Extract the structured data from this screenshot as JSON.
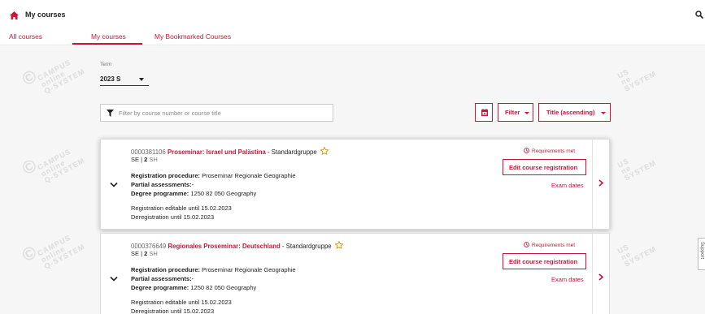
{
  "header": {
    "title": "My courses",
    "tabs": [
      {
        "label": "All courses"
      },
      {
        "label": "My courses"
      },
      {
        "label": "My Bookmarked Courses"
      }
    ]
  },
  "watermark": {
    "line1": "CAMPUS",
    "line2": "online",
    "line3": "Q-SYSTEM",
    "partial1": "US",
    "partial2": "ne",
    "partial3": "SYSTEM"
  },
  "term": {
    "label": "Term",
    "value": "2023 S"
  },
  "filter": {
    "placeholder": "Filter by course number or course title"
  },
  "toolbar": {
    "filter_label": "Filter",
    "sort_label": "Title (ascending)"
  },
  "colors": {
    "accent": "#c5183b"
  },
  "courses": [
    {
      "number": "0000381106",
      "title": "Proseminar: Israel und Palästina",
      "group": "- Standardgruppe",
      "type": "SE",
      "sh": "2",
      "sh_unit": "SH",
      "registration_procedure_label": "Registration procedure:",
      "registration_procedure": "Proseminar Regionale Geographie",
      "partial_assessments_label": "Partial assessments:",
      "partial_assessments": "-",
      "degree_programme_label": "Degree programme:",
      "degree_programme": "1250 82 050 Geography",
      "registration_editable": "Registration editable until 15.02.2023",
      "deregistration": "Deregistration until 15.02.2023",
      "requirements": "Requirements met",
      "edit_label": "Edit course registration",
      "exam_dates": "Exam dates"
    },
    {
      "number": "0000376649",
      "title": "Regionales Proseminar: Deutschland",
      "group": "- Standardgruppe",
      "type": "SE",
      "sh": "2",
      "sh_unit": "SH",
      "registration_procedure_label": "Registration procedure:",
      "registration_procedure": "Proseminar Regionale Geographie",
      "partial_assessments_label": "Partial assessments:",
      "partial_assessments": "-",
      "degree_programme_label": "Degree programme:",
      "degree_programme": "1250 82 050 Geography",
      "registration_editable": "Registration editable until 15.02.2023",
      "deregistration": "Deregistration until 15.02.2023",
      "requirements": "Requirements met",
      "edit_label": "Edit course registration",
      "exam_dates": "Exam dates"
    }
  ],
  "support": {
    "label": "Support"
  }
}
